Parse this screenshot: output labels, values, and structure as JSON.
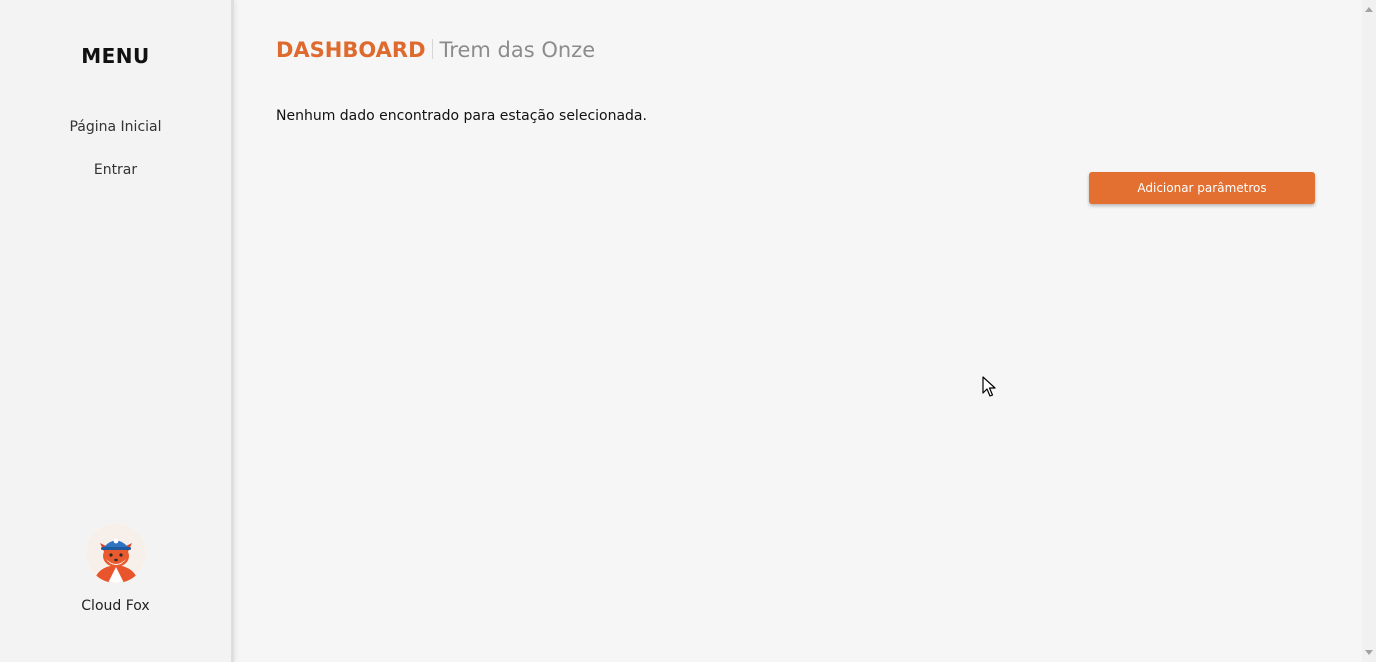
{
  "sidebar": {
    "menu_title": "MENU",
    "items": [
      {
        "label": "Página Inicial"
      },
      {
        "label": "Entrar"
      }
    ],
    "profile": {
      "avatar_icon": "fox-mascot-icon",
      "name": "Cloud Fox"
    }
  },
  "header": {
    "title": "DASHBOARD",
    "subtitle": "Trem das Onze"
  },
  "main": {
    "empty_message": "Nenhum dado encontrado para estação selecionada.",
    "add_button_label": "Adicionar parâmetros"
  },
  "colors": {
    "accent": "#e36f30",
    "title": "#de6a2e",
    "subtitle": "#8c8c8c",
    "background": "#f6f6f6"
  }
}
